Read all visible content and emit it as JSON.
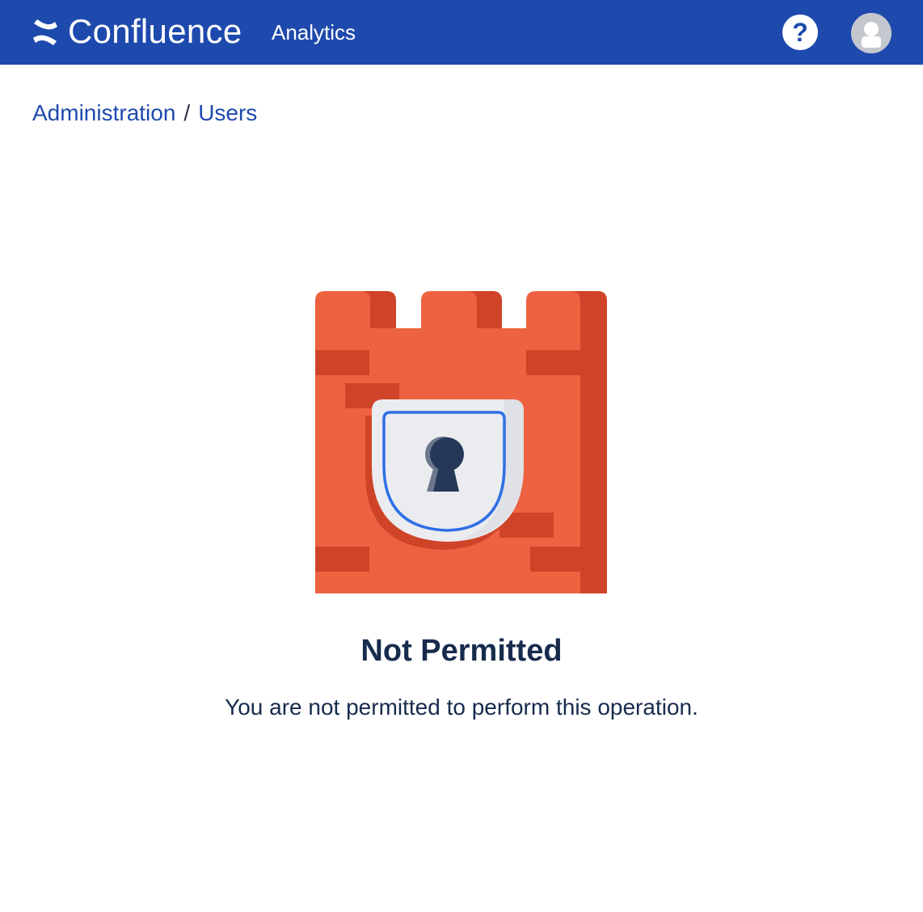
{
  "header": {
    "product_name": "Confluence",
    "nav_link": "Analytics",
    "help_symbol": "?",
    "icons": {
      "logo": "confluence-logo-icon",
      "help": "help-icon",
      "avatar": "user-avatar-icon"
    },
    "colors": {
      "background": "#1e4aad",
      "text": "#ffffff"
    }
  },
  "breadcrumb": {
    "items": [
      {
        "label": "Administration"
      },
      {
        "label": "Users"
      }
    ],
    "separator": "/"
  },
  "error": {
    "title": "Not Permitted",
    "message": "You are not permitted to perform this operation.",
    "illustration": "castle-lock-icon",
    "colors": {
      "castle": "#ed6240",
      "castle_shadow": "#cf4428",
      "shield": "#ebecf0",
      "shield_border": "#2f6fe6",
      "keyhole": "#253858"
    }
  }
}
